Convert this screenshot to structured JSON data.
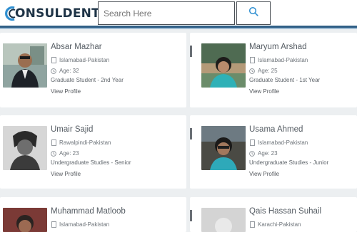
{
  "header": {
    "logo_text": "ONSULDENTS",
    "search_placeholder": "Search Here"
  },
  "profiles": [
    {
      "name": "Absar Mazhar",
      "location": "Islamabad-Pakistan",
      "age": "Age: 32",
      "study": "Graduate Student - 2nd Year",
      "link": "View Profile"
    },
    {
      "name": "Maryum Arshad",
      "location": "Islamabad-Pakistan",
      "age": "Age: 25",
      "study": "Graduate Student - 1st Year",
      "link": "View Profile"
    },
    {
      "name": "Umair Sajid",
      "location": "Rawalpindi-Pakistan",
      "age": "Age: 23",
      "study": "Undergraduate Studies - Senior",
      "link": "View Profile"
    },
    {
      "name": "Usama Ahmed",
      "location": "Islamabad-Pakistan",
      "age": "Age: 23",
      "study": "Undergraduate Studies - Junior",
      "link": "View Profile"
    },
    {
      "name": "Muhammad Matloob",
      "location": "Islamabad-Pakistan"
    },
    {
      "name": "Qais Hassan Suhail",
      "location": "Karachi-Pakistan"
    }
  ],
  "colors": {
    "brand_dark": "#1e3346",
    "accent_blue": "#2f8fd1",
    "header_rule": "#2f5f86"
  }
}
